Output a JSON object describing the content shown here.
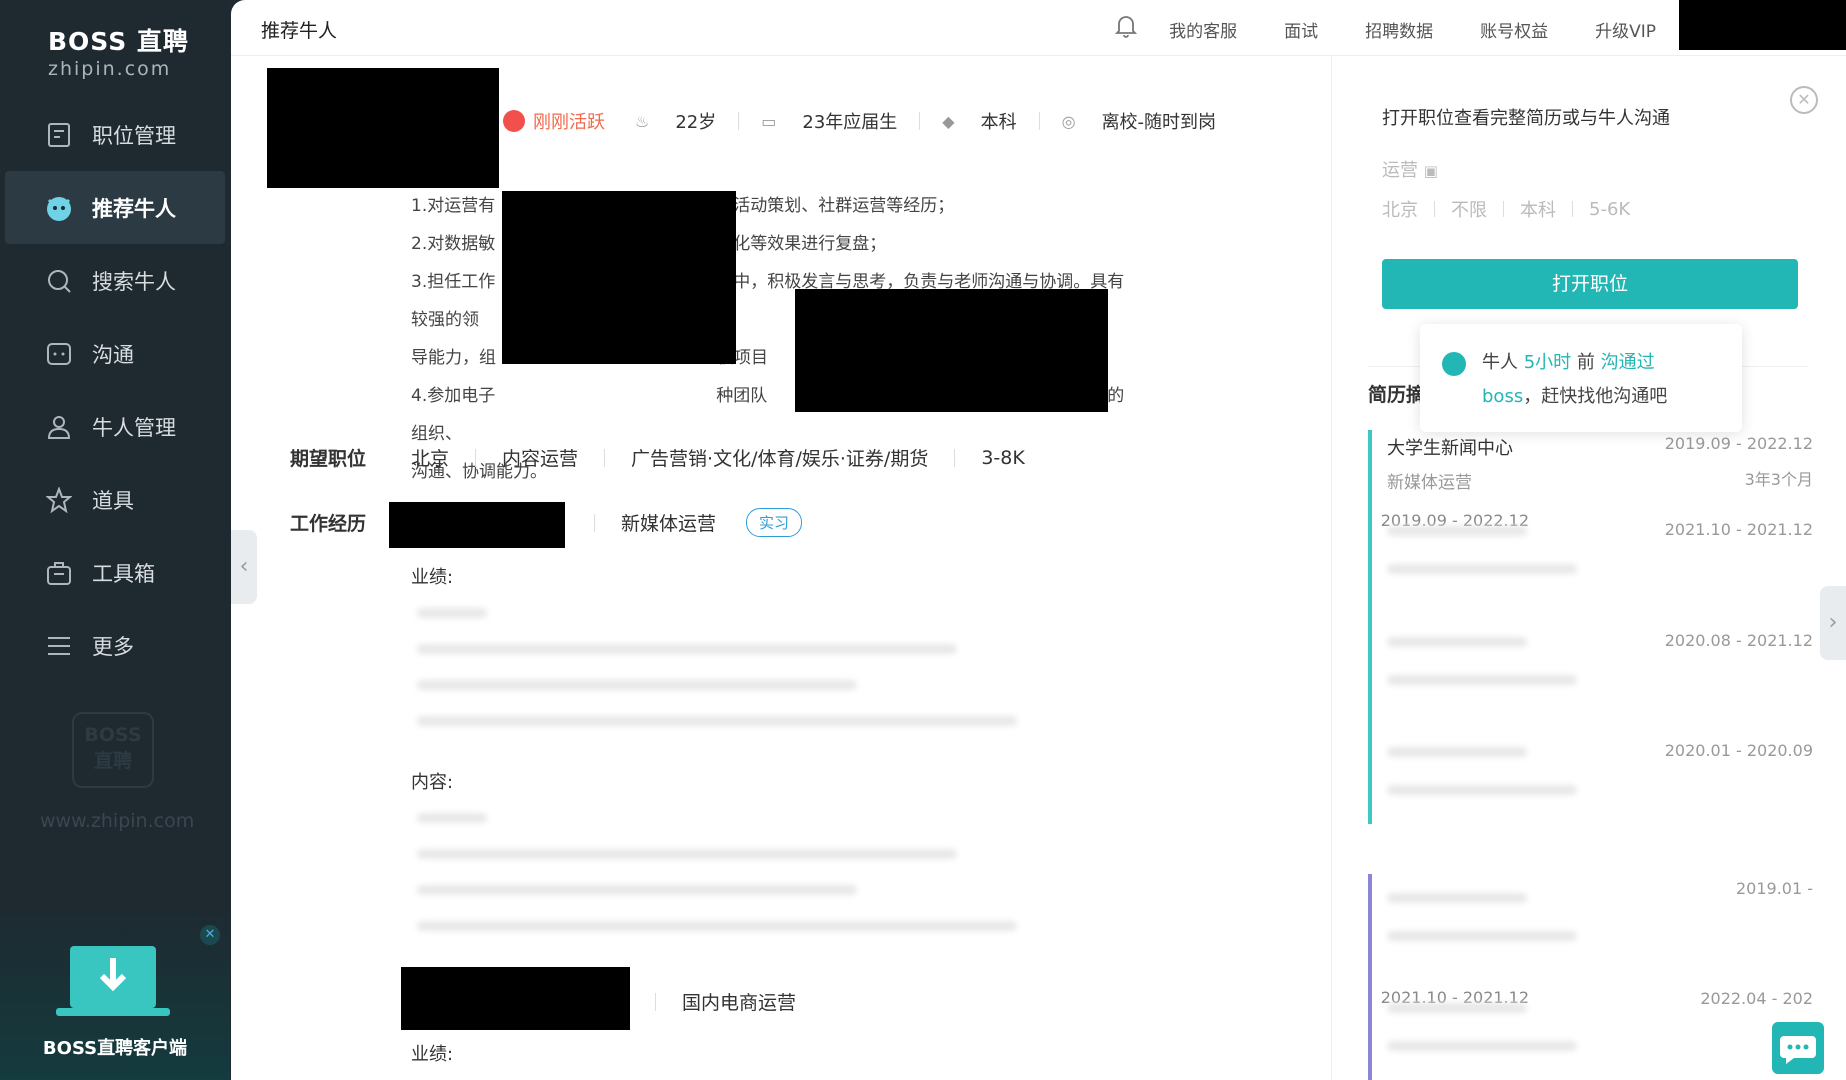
{
  "sidebar": {
    "logo_brand": "BOSS 直聘",
    "logo_domain": "zhipin.com",
    "items": [
      {
        "label": "职位管理",
        "icon": "document-icon"
      },
      {
        "label": "推荐牛人",
        "icon": "mascot-icon"
      },
      {
        "label": "搜索牛人",
        "icon": "search-icon"
      },
      {
        "label": "沟通",
        "icon": "chat-icon"
      },
      {
        "label": "牛人管理",
        "icon": "user-icon"
      },
      {
        "label": "道具",
        "icon": "star-icon"
      },
      {
        "label": "工具箱",
        "icon": "toolbox-icon"
      },
      {
        "label": "更多",
        "icon": "menu-icon"
      }
    ],
    "watermark_text": "BOSS 直聘",
    "watermark_url": "www.zhipin.com",
    "client_label": "BOSS直聘客户端"
  },
  "topbar": {
    "title": "推荐牛人",
    "links": [
      "我的客服",
      "面试",
      "招聘数据",
      "账号权益",
      "升级VIP"
    ]
  },
  "candidate": {
    "active_status": "刚刚活跃",
    "age": "22岁",
    "graduation": "23年应届生",
    "degree": "本科",
    "availability": "离校-随时到岗",
    "desc_lines": [
      "1.对运营有　　　　　　　　　　　　　有活动策划、社群运营等经历；",
      "2.对数据敏　　　　　　　　　　　　　转化等效果进行复盘；",
      "3.担任工作　　　　　　　　　　　　　程中，积极发言与思考，负责与老师沟通与协调。具有较强的领",
      "导能力，组　　　　　　　　　　　　　校项目　　　　　　　　　　　　　　　进行。",
      "4.参加电子　　　　　　　　　　　　　种团队　　　　　　　　　　　　　　　能力和优秀的组织、",
      "沟通、协调能力。"
    ],
    "expect_label": "期望职位",
    "expect": {
      "city": "北京",
      "position": "内容运营",
      "industry": "广告营销·文化/体育/娱乐·证券/期货",
      "salary": "3-8K"
    },
    "work_label": "工作经历",
    "jobs": [
      {
        "title": "新媒体运营",
        "tag": "实习",
        "date": "2019.09 - 2022.12",
        "perf_label": "业绩:",
        "content_label": "内容:"
      },
      {
        "title": "国内电商运营",
        "date": "2021.10 - 2021.12",
        "perf_label": "业绩:"
      }
    ]
  },
  "right_panel": {
    "header": "打开职位查看完整简历或与牛人沟通",
    "job_name": "运营",
    "meta": [
      "北京",
      "不限",
      "本科",
      "5-6K"
    ],
    "open_button": "打开职位",
    "tooltip": {
      "prefix": "牛人 ",
      "time": "5小时",
      "mid": " 前 ",
      "action": "沟通过",
      "line2_hl": "boss",
      "line2": "，赶快找他沟通吧"
    },
    "section_title": "简历摘",
    "timeline": [
      {
        "name": "大学生新闻中心",
        "role": "新媒体运营",
        "date": "2019.09 - 2022.12",
        "duration": "3年3个月"
      },
      {
        "date": "2021.10 - 2021.12"
      },
      {
        "date": "2020.08 - 2021.12"
      },
      {
        "date": "2020.01 - 2020.09"
      },
      {
        "date": "2019.01 -"
      },
      {
        "date": "2022.04 - 202"
      }
    ]
  }
}
